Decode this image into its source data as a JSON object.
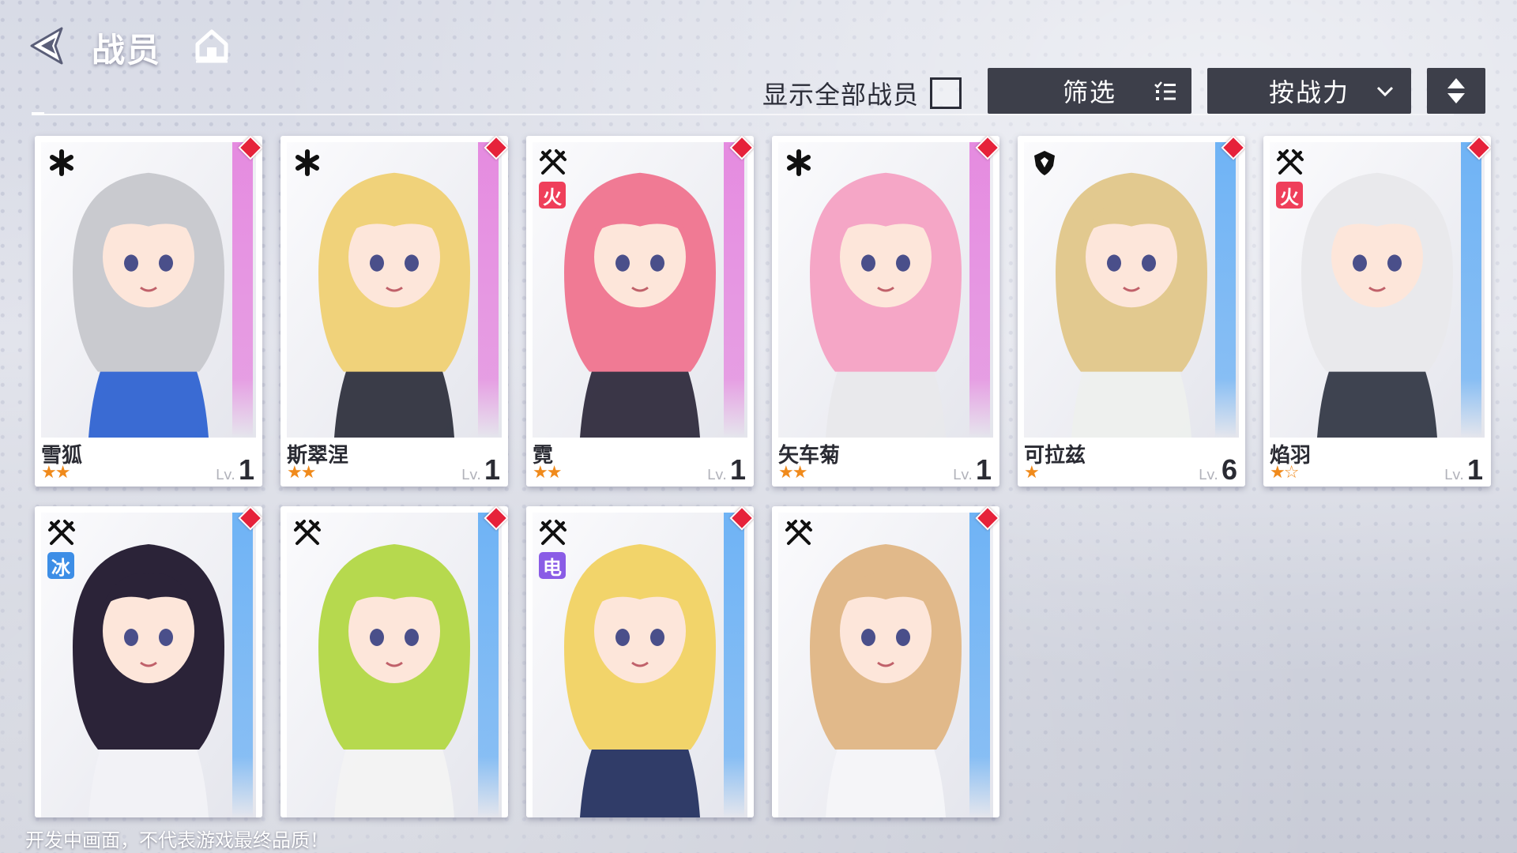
{
  "header": {
    "title": "战员",
    "back_icon": "back-arrow-icon",
    "home_icon": "home-icon"
  },
  "toolbar": {
    "show_all_label": "显示全部战员",
    "show_all_checked": false,
    "filter_label": "筛选",
    "sort_label": "按战力",
    "filter_icon": "list-filter-icon",
    "sort_icon": "chevron-down-icon",
    "order_icon": "sort-order-icon"
  },
  "colors": {
    "pink_stripe": "#e58be0",
    "blue_stripe": "#6fb3f5",
    "fire": "#ef3f5a",
    "ice": "#3d8ee6",
    "electric": "#8a5ce6",
    "star": "#f08a1b",
    "button_bg": "#3d3f4a",
    "gem": "#e6223a"
  },
  "level_prefix": "Lv.",
  "operators": [
    {
      "name": "雪狐",
      "stars": "★★",
      "level": "1",
      "class_icon": "asterisk-class-icon",
      "element": "",
      "stripe": "#e58be0",
      "hair": "#c9cacf",
      "outfit": "#2a5fd0"
    },
    {
      "name": "斯翠涅",
      "stars": "★★",
      "level": "1",
      "class_icon": "asterisk-class-icon",
      "element": "",
      "stripe": "#e58be0",
      "hair": "#f0d27a",
      "outfit": "#2a2d3a"
    },
    {
      "name": "霓",
      "stars": "★★",
      "level": "1",
      "class_icon": "crossed-swords-class-icon",
      "element": "火",
      "stripe": "#e58be0",
      "hair": "#f07a94",
      "outfit": "#2a2638"
    },
    {
      "name": "矢车菊",
      "stars": "★★",
      "level": "1",
      "class_icon": "asterisk-class-icon",
      "element": "",
      "stripe": "#e58be0",
      "hair": "#f5a6c6",
      "outfit": "#e8e8ec"
    },
    {
      "name": "可拉兹",
      "stars": "★",
      "level": "6",
      "class_icon": "shield-class-icon",
      "element": "",
      "stripe": "#6fb3f5",
      "hair": "#e2c98f",
      "outfit": "#eef0ee"
    },
    {
      "name": "焰羽",
      "stars": "★☆",
      "level": "1",
      "class_icon": "crossed-swords-class-icon",
      "element": "火",
      "stripe": "#6fb3f5",
      "hair": "#e9e9ec",
      "outfit": "#2f3442"
    },
    {
      "name": "",
      "stars": "",
      "level": "",
      "class_icon": "crossed-swords-class-icon",
      "element": "冰",
      "stripe": "#6fb3f5",
      "hair": "#2b2338",
      "outfit": "#f2f2f6"
    },
    {
      "name": "",
      "stars": "",
      "level": "",
      "class_icon": "crossed-swords-class-icon",
      "element": "",
      "stripe": "#6fb3f5",
      "hair": "#b6d94e",
      "outfit": "#f3f3f3"
    },
    {
      "name": "",
      "stars": "",
      "level": "",
      "class_icon": "crossed-swords-class-icon",
      "element": "电",
      "stripe": "#6fb3f5",
      "hair": "#f2d46a",
      "outfit": "#1f2c5c"
    },
    {
      "name": "",
      "stars": "",
      "level": "",
      "class_icon": "crossed-swords-class-icon",
      "element": "",
      "stripe": "#6fb3f5",
      "hair": "#e1b98a",
      "outfit": "#f5f5f8"
    }
  ],
  "footer_note": "开发中画面，不代表游戏最终品质！"
}
